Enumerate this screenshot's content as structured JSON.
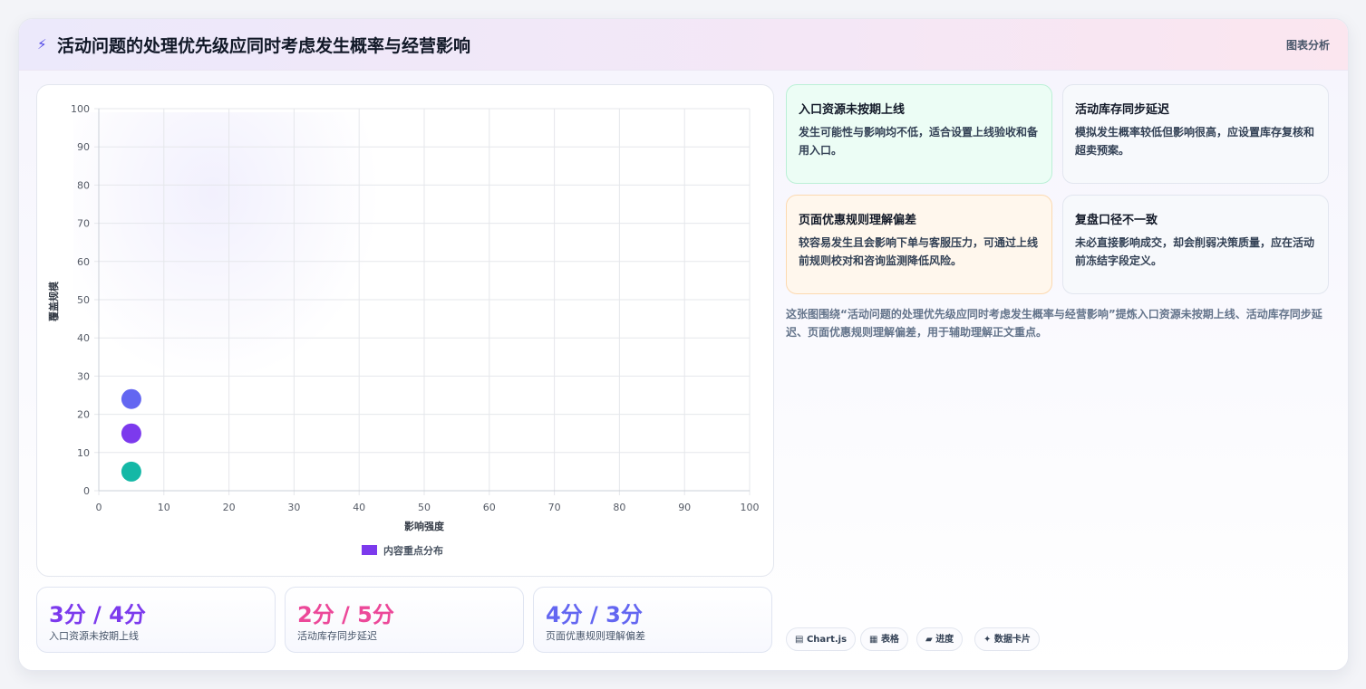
{
  "header": {
    "icon": "bolt-icon",
    "title": "活动问题的处理优先级应同时考虑发生概率与经营影响",
    "tag": "图表分析"
  },
  "chart_data": {
    "type": "scatter",
    "xlabel": "影响强度",
    "ylabel": "覆盖规模",
    "xlim": [
      0,
      100
    ],
    "ylim": [
      0,
      100
    ],
    "xticks": [
      "0",
      "10",
      "20",
      "30",
      "40",
      "50",
      "60",
      "70",
      "80",
      "90",
      "100"
    ],
    "yticks": [
      "0",
      "10",
      "20",
      "30",
      "40",
      "50",
      "60",
      "70",
      "80",
      "90",
      "100"
    ],
    "grid": true,
    "legend_position": "bottom",
    "series": [
      {
        "name": "内容重点分布",
        "color": "#7c3aed",
        "points": [
          {
            "x": 5,
            "y": 24,
            "color": "#6366f1"
          },
          {
            "x": 5,
            "y": 15,
            "color": "#7c3aed"
          },
          {
            "x": 5,
            "y": 5,
            "color": "#14b8a6"
          }
        ]
      }
    ]
  },
  "stats": [
    {
      "value": "3分 / 4分",
      "label": "入口资源未按期上线",
      "color": "#7c3aed"
    },
    {
      "value": "2分 / 5分",
      "label": "活动库存同步延迟",
      "color": "#ec4899"
    },
    {
      "value": "4分 / 3分",
      "label": "页面优惠规则理解偏差",
      "color": "#6366f1"
    }
  ],
  "cards": [
    {
      "title": "入口资源未按期上线",
      "desc": "发生可能性与影响均不低，适合设置上线验收和备用入口。",
      "bg": "#ecfdf5",
      "border": "#bbf0d6"
    },
    {
      "title": "活动库存同步延迟",
      "desc": "模拟发生概率较低但影响很高，应设置库存复核和超卖预案。",
      "bg": "#f7f9fc",
      "border": "#e2e6ef"
    },
    {
      "title": "页面优惠规则理解偏差",
      "desc": "较容易发生且会影响下单与客服压力，可通过上线前规则校对和咨询监测降低风险。",
      "bg": "#fff7ed",
      "border": "#fcd9b0"
    },
    {
      "title": "复盘口径不一致",
      "desc": "未必直接影响成交，却会削弱决策质量，应在活动前冻结字段定义。",
      "bg": "#f7f9fc",
      "border": "#e2e6ef"
    }
  ],
  "summary": "这张图围绕“活动问题的处理优先级应同时考虑发生概率与经营影响”提炼入口资源未按期上线、活动库存同步延迟、页面优惠规则理解偏差，用于辅助理解正文重点。",
  "chips": [
    {
      "icon": "chart-icon",
      "glyph": "▤",
      "label": "Chart.js"
    },
    {
      "icon": "table-icon",
      "glyph": "▦",
      "label": "表格"
    },
    {
      "icon": "progress-icon",
      "glyph": "▰",
      "label": "进度"
    },
    {
      "icon": "sparkle-icon",
      "glyph": "✦",
      "label": "数据卡片"
    }
  ]
}
